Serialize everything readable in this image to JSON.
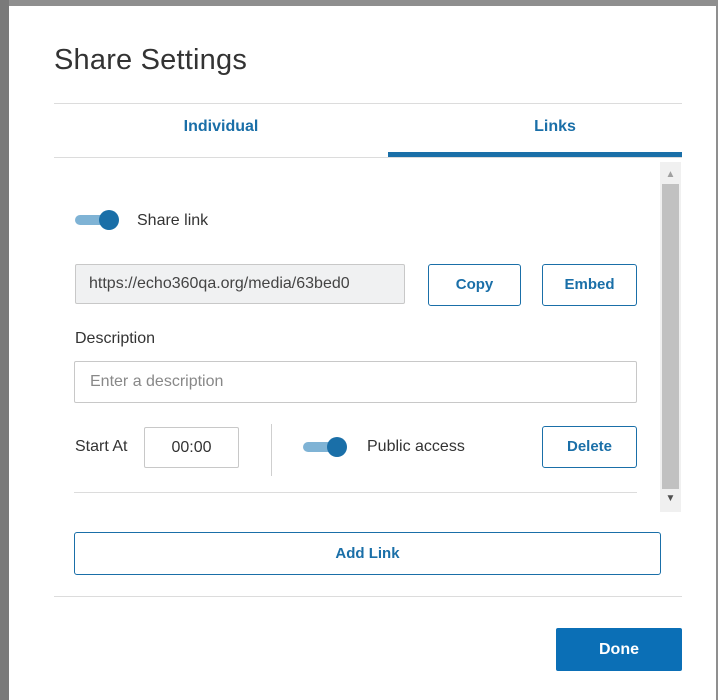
{
  "dialog": {
    "title": "Share Settings"
  },
  "tabs": [
    {
      "label": "Individual",
      "active": false
    },
    {
      "label": "Links",
      "active": true
    }
  ],
  "link": {
    "share_link_label": "Share link",
    "share_link_enabled": true,
    "url": "https://echo360qa.org/media/63bed0",
    "copy_label": "Copy",
    "embed_label": "Embed",
    "description_label": "Description",
    "description_placeholder": "Enter a description",
    "start_at_label": "Start At",
    "start_at_value": "00:00",
    "public_access_label": "Public access",
    "public_access_enabled": true,
    "delete_label": "Delete"
  },
  "add_link_label": "Add Link",
  "done_label": "Done",
  "colors": {
    "accent": "#1a6fa8",
    "primary_button": "#0b6fb6",
    "toggle_track": "#7fb3d5"
  },
  "icons": {
    "scroll_up": "triangle-up-icon",
    "scroll_down": "triangle-down-icon"
  }
}
